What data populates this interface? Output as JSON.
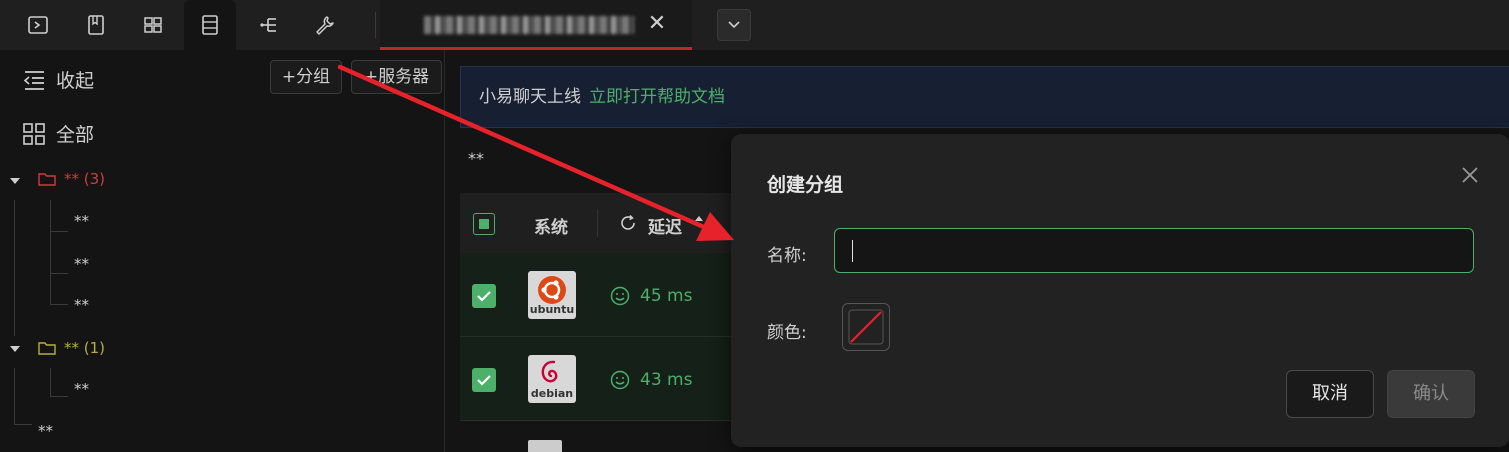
{
  "topbar": {
    "icons": [
      "terminal-icon",
      "book-icon",
      "layout-icon",
      "server-list-icon",
      "tree-icon",
      "wrench-icon"
    ],
    "tab_close": "✕"
  },
  "sidebar": {
    "collapse_label": "收起",
    "all_label": "全部",
    "add_group_label": "+分组",
    "add_server_label": "+服务器",
    "groups": [
      {
        "label": "** (3)",
        "color": "#d23b3b",
        "children": [
          "**",
          "**",
          "**"
        ]
      },
      {
        "label": "** (1)",
        "color": "#b5b03a",
        "children": [
          "**"
        ]
      }
    ],
    "loose_item": "**"
  },
  "main": {
    "notice_text": "小易聊天上线",
    "notice_link": "立即打开帮助文档",
    "breadcrumb": "**",
    "columns": [
      "系统",
      "延迟"
    ],
    "rows": [
      {
        "os": "ubuntu",
        "latency": "45 ms"
      },
      {
        "os": "debian",
        "latency": "43 ms"
      }
    ]
  },
  "dialog": {
    "title": "创建分组",
    "name_label": "名称:",
    "name_value": "",
    "color_label": "颜色:",
    "cancel_label": "取消",
    "confirm_label": "确认"
  },
  "colors": {
    "accent": "#4caf6a",
    "arrow": "#e8222b",
    "tab_underline": "#c0272d"
  }
}
